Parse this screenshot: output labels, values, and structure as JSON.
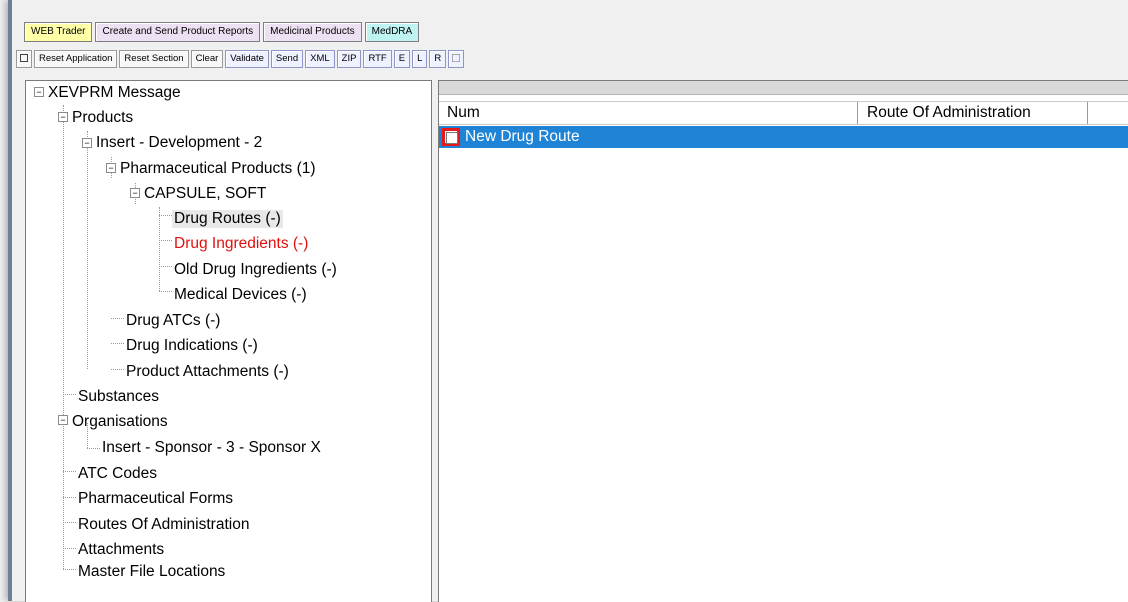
{
  "tabs": [
    {
      "label": "WEB Trader"
    },
    {
      "label": "Create and Send Product Reports"
    },
    {
      "label": "Medicinal Products"
    },
    {
      "label": "MedDRA"
    }
  ],
  "toolbar": {
    "reset_application": "Reset Application",
    "reset_section": "Reset Section",
    "clear": "Clear",
    "validate": "Validate",
    "send": "Send",
    "xml": "XML",
    "zip": "ZIP",
    "rtf": "RTF",
    "e": "E",
    "l": "L",
    "r": "R"
  },
  "tree": {
    "root": "XEVPRM Message",
    "products": "Products",
    "insert_development": "Insert - Development - 2",
    "pharmaceutical_products": "Pharmaceutical Products (1)",
    "capsule_soft": "CAPSULE, SOFT",
    "drug_routes": "Drug Routes (-)",
    "drug_ingredients": "Drug Ingredients (-)",
    "old_drug_ingredients": "Old Drug Ingredients (-)",
    "medical_devices": "Medical Devices (-)",
    "drug_atcs": "Drug ATCs (-)",
    "drug_indications": "Drug Indications (-)",
    "product_attachments": "Product Attachments (-)",
    "substances": "Substances",
    "organisations": "Organisations",
    "insert_sponsor": "Insert - Sponsor - 3 - Sponsor X",
    "atc_codes": "ATC Codes",
    "pharmaceutical_forms": "Pharmaceutical Forms",
    "routes_of_administration": "Routes Of Administration",
    "attachments": "Attachments",
    "master_file_locations": "Master File Locations",
    "expanded_symbol": "−"
  },
  "grid": {
    "columns": [
      "Num",
      "Route Of Administration"
    ],
    "rows": [
      {
        "label": "New Drug Route",
        "checked": false
      }
    ]
  },
  "colors": {
    "selected_row": "#1f83d6",
    "error_text": "#e01010",
    "tab_webtrader": "#ffffa8",
    "tab_reports": "#ede0f2",
    "tab_meddra": "#bff3f2",
    "checkbox_highlight": "#e51b1b"
  }
}
